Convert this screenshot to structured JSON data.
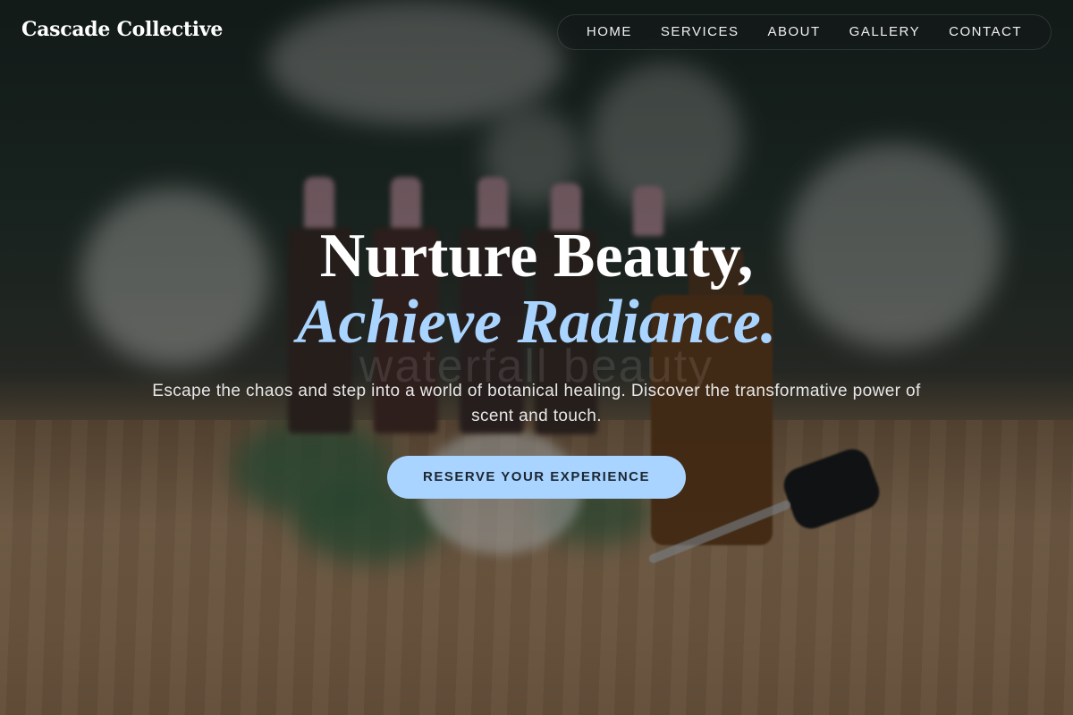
{
  "brand": {
    "name": "Cascade Collective"
  },
  "nav": {
    "items": [
      {
        "label": "HOME"
      },
      {
        "label": "SERVICES"
      },
      {
        "label": "ABOUT"
      },
      {
        "label": "GALLERY"
      },
      {
        "label": "CONTACT"
      }
    ]
  },
  "hero": {
    "headline_line1": "Nurture Beauty,",
    "headline_line2": "Achieve Radiance.",
    "watermark": "waterfall beauty",
    "subtitle": "Escape the chaos and step into a world of botanical healing. Discover the transformative power of scent and touch.",
    "cta_label": "RESERVE YOUR EXPERIENCE"
  },
  "colors": {
    "accent": "#a9d4ff",
    "cta_text": "#1b2733",
    "headline": "#ffffff"
  }
}
